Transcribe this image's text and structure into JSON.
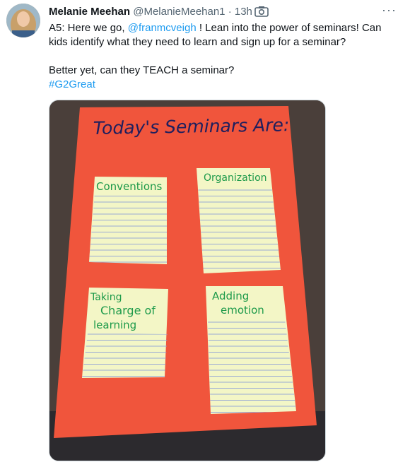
{
  "tweet": {
    "author_name": "Melanie Meehan",
    "author_handle": "@MelanieMeehan1",
    "separator": "·",
    "time": "13h",
    "more_label": "···",
    "text_line1_a": "A5: Here we go, ",
    "mention": "@franmcveigh",
    "text_line1_b": " ! Lean into the power of seminars! Can kids identify what they need to learn and sign up for a seminar?",
    "text_line2": "Better yet, can they TEACH a seminar?",
    "hashtag": "#G2Great"
  },
  "media": {
    "board_title": "Today's Seminars Are:",
    "notes": [
      {
        "label": "Conventions"
      },
      {
        "label": "Organization"
      },
      {
        "label_lines": [
          "Taking",
          "Charge of",
          "learning"
        ]
      },
      {
        "label_lines": [
          "Adding",
          "emotion"
        ]
      }
    ]
  },
  "colors": {
    "link": "#1d9bf0",
    "board": "#f0553c",
    "note": "#f3f6c6",
    "marker": "#1d9a4a",
    "title_ink": "#1f1f5e"
  }
}
